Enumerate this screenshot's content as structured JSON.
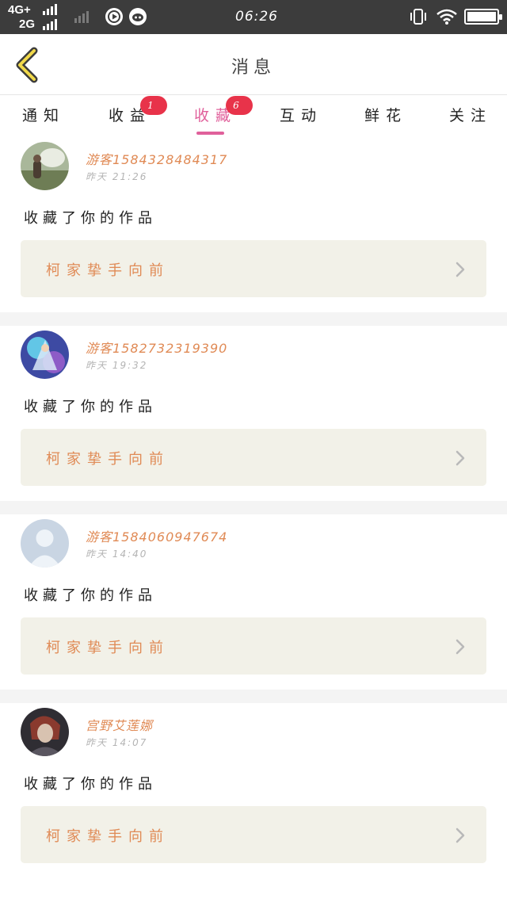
{
  "status_bar": {
    "network_top": "4G+",
    "network_bottom": "2G",
    "time": "06:26"
  },
  "header": {
    "title": "消息"
  },
  "tabs": [
    {
      "label": "通知",
      "badge": ""
    },
    {
      "label": "收益",
      "badge": "1"
    },
    {
      "label": "收藏",
      "badge": "6",
      "active": true
    },
    {
      "label": "互动",
      "badge": ""
    },
    {
      "label": "鲜花",
      "badge": ""
    },
    {
      "label": "关注",
      "badge": ""
    }
  ],
  "notifications": [
    {
      "user": "游客1584328484317",
      "time": "昨天 21:26",
      "action": "收藏了你的作品",
      "work": "柯家挚手向前"
    },
    {
      "user": "游客1582732319390",
      "time": "昨天 19:32",
      "action": "收藏了你的作品",
      "work": "柯家挚手向前"
    },
    {
      "user": "游客1584060947674",
      "time": "昨天 14:40",
      "action": "收藏了你的作品",
      "work": "柯家挚手向前"
    },
    {
      "user": "宫野艾莲娜",
      "time": "昨天 14:07",
      "action": "收藏了你的作品",
      "work": "柯家挚手向前"
    }
  ],
  "colors": {
    "accent": "#e0609b",
    "badge": "#e8334a",
    "username": "#e08a55",
    "work_bg": "#f2f1e8"
  }
}
